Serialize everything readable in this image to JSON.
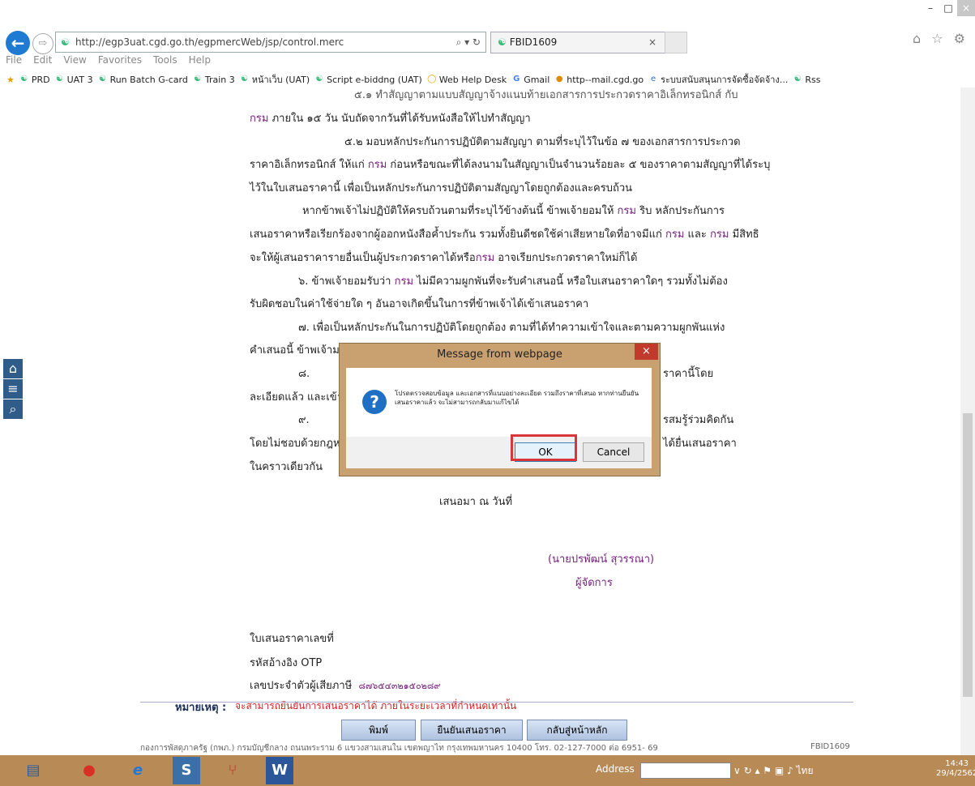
{
  "browser": {
    "url": "http://egp3uat.cgd.go.th/egpmercWeb/jsp/control.merc",
    "address_controls": "⌕ ▾ ↻",
    "tab_title": "FBID1609",
    "tab_close": "×",
    "menu": [
      "File",
      "Edit",
      "View",
      "Favorites",
      "Tools",
      "Help"
    ],
    "favorites": [
      "PRD",
      "UAT 3",
      "Run Batch G-card",
      "Train 3",
      "หน้าเว็บ (UAT)",
      "Script e-biddng (UAT)",
      "Web Help Desk",
      "Gmail",
      "http--mail.cgd.go",
      "ระบบสนับสนุนการจัดซื้อจัดจ้าง...",
      "Rss"
    ],
    "window_controls": [
      "–",
      "□",
      "×"
    ],
    "top_icons": "⌂ ☆ ⚙"
  },
  "document": {
    "line_partial": "๕.๑ ทำสัญญาตามแบบสัญญาจ้างแนบท้ายเอกสารการประกวดราคาอิเล็กทรอนิกส์ กับ",
    "l1a": "กรม",
    "l1b": " ภายใน ๑๕ วัน นับถัดจากวันที่ได้รับหนังสือให้ไปทำสัญญา",
    "l2": "๕.๒ มอบหลักประกันการปฏิบัติตามสัญญา ตามที่ระบุไว้ในข้อ ๗ ของเอกสารการประกวด",
    "l3a": "ราคาอิเล็กทรอนิกส์ ให้แก่ ",
    "l3b": "กรม",
    "l3c": " ก่อนหรือขณะที่ได้ลงนามในสัญญาเป็นจำนวนร้อยละ ๕ ของราคาตามสัญญาที่ได้ระบุ",
    "l4": "ไว้ในใบเสนอราคานี้ เพื่อเป็นหลักประกันการปฏิบัติตามสัญญาโดยถูกต้องและครบถ้วน",
    "l5a": "หากข้าพเจ้าไม่ปฏิบัติให้ครบถ้วนตามที่ระบุไว้ข้างต้นนี้ ข้าพเจ้ายอมให้ ",
    "l5b": "กรม",
    "l5c": " ริบ หลักประกันการ",
    "l6a": "เสนอราคาหรือเรียกร้องจากผู้ออกหนังสือค้ำประกัน รวมทั้งยินดีชดใช้ค่าเสียหายใดที่อาจมีแก่ ",
    "l6b": "กรม",
    "l6c": " และ ",
    "l6d": "กรม",
    "l6e": " มีสิทธิ",
    "l7a": "จะให้ผู้เสนอราคารายอื่นเป็นผู้ประกวดราคาได้หรือ",
    "l7b": "กรม",
    "l7c": " อาจเรียกประกวดราคาใหม่ก็ได้",
    "l8a": "๖. ข้าพเจ้ายอมรับว่า ",
    "l8b": "กรม",
    "l8c": " ไม่มีความผูกพันที่จะรับคำเสนอนี้ หรือใบเสนอราคาใดๆ รวมทั้งไม่ต้อง",
    "l9": "รับผิดชอบในค่าใช้จ่ายใด ๆ อันอาจเกิดขึ้นในการที่ข้าพเจ้าได้เข้าเสนอราคา",
    "l10": "๗. เพื่อเป็นหลักประกันในการปฏิบัติโดยถูกต้อง ตามที่ได้ทำความเข้าใจและตามความผูกพันแห่ง",
    "l11": "คำเสนอนี้ ข้าพเจ้ามอ",
    "l12a": "๘.",
    "l12b": "ราคานี้โดย",
    "l13": "ละเอียดแล้ว และเข้าใ",
    "l14a": "๙.",
    "l14b": "รสมรู้ร่วมคิดกัน",
    "l15a": "โดยไม่ชอบด้วยกฎหม",
    "l15b": "ได้ยื่นเสนอราคา",
    "l16": "ในคราวเดียวกัน",
    "offer_date": "เสนอมา ณ วันที่",
    "signer_name": "(นายปรพัฒน์ สุวรรณา)",
    "signer_title": "ผู้จัดการ",
    "quote_no_label": "ใบเสนอราคาเลขที่",
    "otp_label": "รหัสอ้างอิง OTP",
    "taxid_label": "เลขประจำตัวผู้เสียภาษี",
    "taxid_value": "๘๗๖๕๔๓๒๑๕๐๒๘๙",
    "note_label": "หมายเหตุ :",
    "note_text": "จะสามารถยืนยันการเสนอราคาได้ ภายในระยะเวลาที่กำหนดเท่านั้น",
    "btn_print": "พิมพ์",
    "btn_confirm": "ยืนยันเสนอราคา",
    "btn_home": "กลับสู่หน้าหลัก",
    "footer": "กองการพัสดุภาครัฐ (กพภ.) กรมบัญชีกลาง ถนนพระราม 6 แขวงสามเสนใน เขตพญาไท กรุงเทพมหานคร 10400 โทร. 02-127-7000 ต่อ 6951- 69",
    "footer_code": "FBID1609"
  },
  "side_buttons": [
    "⌂",
    "≡",
    "⌕"
  ],
  "dialog": {
    "title": "Message from webpage",
    "close": "×",
    "icon": "?",
    "message": "โปรดตรวจสอบข้อมูล และเอกสารที่แนบอย่างละเอียด รวมถึงราคาที่เสนอ หากท่านยืนยันเสนอราคาแล้ว จะไม่สามารถกลับมาแก้ไขได้",
    "ok": "OK",
    "cancel": "Cancel"
  },
  "taskbar": {
    "apps": [
      "▤",
      "●",
      "e",
      "S",
      "⑂",
      "W"
    ],
    "address_label": "Address",
    "tray": "∨ ↻ ▴ ⚑ ▣ ♪ ไทย",
    "time": "14:43",
    "date": "29/4/2562"
  },
  "colors": {
    "accent_link": "#7a2080",
    "note_red": "#d22020",
    "dialog_frame": "#c9a070",
    "taskbar": "#b88a56",
    "highlight": "#d8363a"
  }
}
